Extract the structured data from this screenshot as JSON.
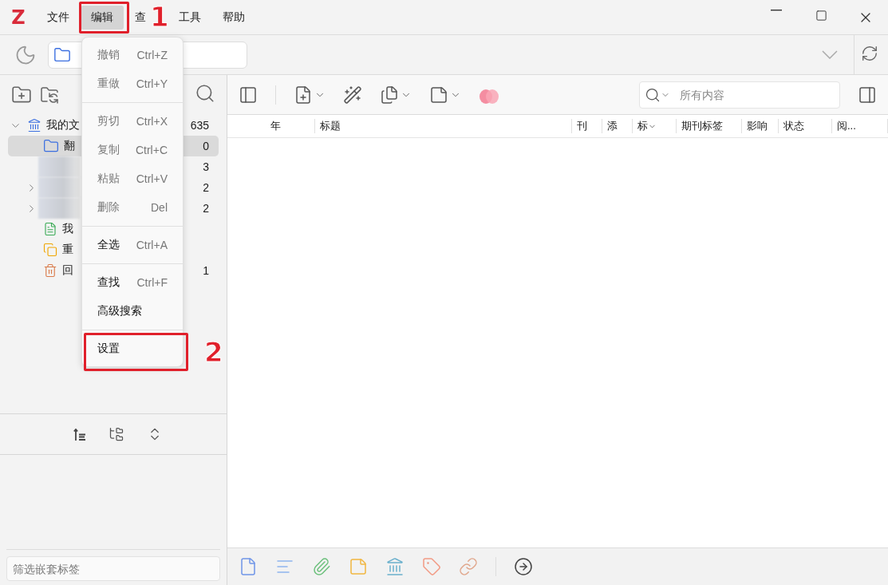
{
  "app": {
    "logo": "Z"
  },
  "menubar": [
    {
      "label": "文件",
      "selected": false
    },
    {
      "label": "编辑",
      "selected": true
    },
    {
      "label": "查",
      "selected": false
    },
    {
      "label": "工具",
      "selected": false
    },
    {
      "label": "帮助",
      "selected": false
    }
  ],
  "edit_menu": [
    {
      "kind": "item",
      "label": "撤销",
      "shortcut": "Ctrl+Z",
      "disabled": true
    },
    {
      "kind": "item",
      "label": "重做",
      "shortcut": "Ctrl+Y",
      "disabled": true
    },
    {
      "kind": "separator"
    },
    {
      "kind": "item",
      "label": "剪切",
      "shortcut": "Ctrl+X",
      "disabled": true
    },
    {
      "kind": "item",
      "label": "复制",
      "shortcut": "Ctrl+C",
      "disabled": true
    },
    {
      "kind": "item",
      "label": "粘贴",
      "shortcut": "Ctrl+V",
      "disabled": true
    },
    {
      "kind": "item",
      "label": "删除",
      "shortcut": "Del",
      "disabled": true
    },
    {
      "kind": "separator"
    },
    {
      "kind": "item",
      "label": "全选",
      "shortcut": "Ctrl+A",
      "disabled": false
    },
    {
      "kind": "separator"
    },
    {
      "kind": "item",
      "label": "查找",
      "shortcut": "Ctrl+F",
      "disabled": false
    },
    {
      "kind": "item",
      "label": "高级搜索",
      "disabled": false
    },
    {
      "kind": "separator"
    },
    {
      "kind": "item",
      "label": "设置",
      "disabled": false
    }
  ],
  "tree": [
    {
      "kind": "library",
      "label": "我的文",
      "count": "635",
      "expanded": true,
      "selected": false,
      "children": [
        {
          "kind": "folder",
          "label": "翻",
          "count": "0",
          "selected": true
        },
        {
          "kind": "redacted",
          "count": "3",
          "selected": false
        },
        {
          "kind": "redacted",
          "count": "2",
          "expanded": false,
          "selected": false
        },
        {
          "kind": "redacted",
          "count": "2",
          "expanded": false,
          "selected": false
        },
        {
          "kind": "unfiled",
          "label": "我",
          "selected": false
        },
        {
          "kind": "duplicates",
          "label": "重",
          "selected": false
        },
        {
          "kind": "trash",
          "label": "回",
          "count": "1",
          "selected": false
        }
      ]
    }
  ],
  "tag_filter": {
    "placeholder": "筛选嵌套标签"
  },
  "search": {
    "placeholder": "所有内容"
  },
  "columns": [
    {
      "label": "年",
      "sorted": false
    },
    {
      "label": "标题",
      "sorted": false
    },
    {
      "label": "刊",
      "sorted": false
    },
    {
      "label": "添",
      "sorted": false
    },
    {
      "label": "标",
      "sorted": true
    },
    {
      "label": "期刊标签",
      "sorted": false
    },
    {
      "label": "影响",
      "sorted": false
    },
    {
      "label": "状态",
      "sorted": false
    },
    {
      "label": "阅...",
      "sorted": false
    }
  ],
  "annotations": [
    {
      "label": "1"
    },
    {
      "label": "2"
    }
  ]
}
